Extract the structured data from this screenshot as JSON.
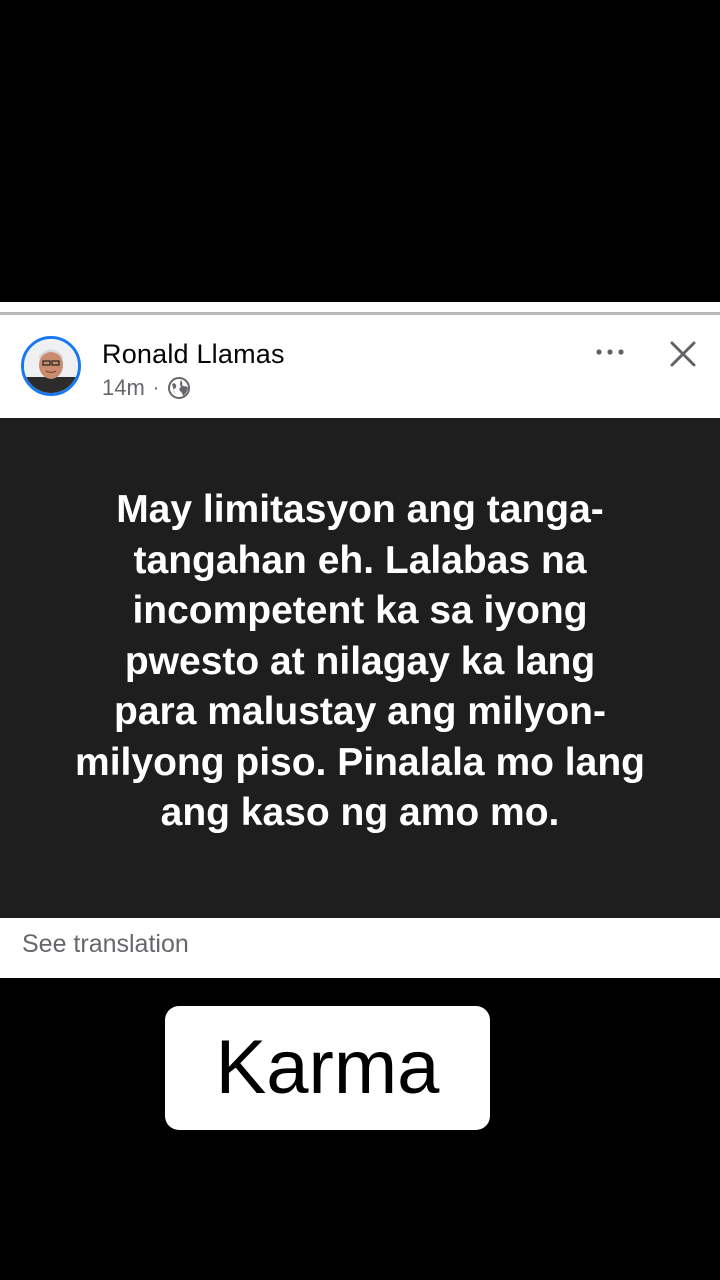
{
  "post": {
    "author": "Ronald Llamas",
    "time": "14m",
    "separator": "·",
    "audience_icon": "globe-icon",
    "body": "May limitasyon ang tanga-tangahan eh. Lalabas na incompetent ka sa iyong pwesto at nilagay ka lang para malustay ang milyon-milyong piso. Pinalala mo lang ang kaso ng amo mo.",
    "body_lines": [
      "May limitasyon ang tanga-",
      "tangahan eh. Lalabas na",
      "incompetent ka sa iyong",
      "pwesto at nilagay ka lang",
      "para malustay ang milyon-",
      "milyong piso. Pinalala mo lang",
      "ang kaso ng amo mo."
    ],
    "see_translation": "See translation",
    "more_icon": "more-options-icon",
    "close_icon": "close-icon"
  },
  "overlay": {
    "caption": "Karma"
  },
  "colors": {
    "avatar_ring": "#1877f2",
    "post_background": "#1e1e1e",
    "meta_text": "#65676b"
  }
}
